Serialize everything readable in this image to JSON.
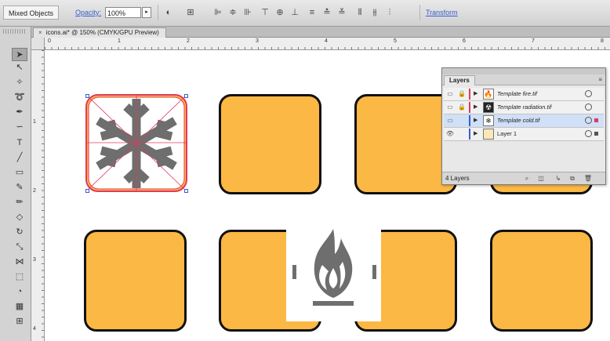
{
  "control_bar": {
    "selection_label": "Mixed Objects",
    "opacity_label": "Opacity:",
    "opacity_value": "100%",
    "transform_label": "Transform",
    "tool_icons": [
      "style-icon",
      "recolor-icon",
      "align-left-icon",
      "align-hcenter-icon",
      "align-right-icon",
      "align-top-icon",
      "align-vcenter-icon",
      "align-bottom-icon",
      "dist-top-icon",
      "dist-vcenter-icon",
      "dist-bottom-icon",
      "dist-left-icon",
      "dist-hcenter-icon",
      "dist-right-icon"
    ]
  },
  "document_tab": {
    "close_glyph": "×",
    "title": "icons.ai* @ 150% (CMYK/GPU Preview)"
  },
  "rulers": {
    "top_labels": [
      "0",
      "1",
      "2",
      "3",
      "4",
      "5",
      "6",
      "7",
      "8"
    ],
    "left_labels": [
      "1",
      "2",
      "3",
      "4"
    ]
  },
  "tools": [
    "selection",
    "direct-selection",
    "magic-wand",
    "lasso",
    "pen",
    "curvature",
    "type",
    "line-segment",
    "rectangle",
    "paintbrush",
    "pencil",
    "eraser",
    "rotate",
    "scale",
    "width",
    "free-transform",
    "shape-builder",
    "perspective-grid",
    "mesh"
  ],
  "canvas": {
    "tile_color": "#fbb844",
    "icon_color": "#6e6e6e",
    "selection_color": "#e03a5a"
  },
  "layers_panel": {
    "tab_label": "Layers",
    "count_label": "4 Layers",
    "layers": [
      {
        "name": "Template fire.tif",
        "template": true,
        "color": "#e03a5a",
        "thumb": "flame-icon",
        "active": false
      },
      {
        "name": "Template radiation.tif",
        "template": true,
        "color": "#e03a5a",
        "thumb": "radiation-icon",
        "active": false
      },
      {
        "name": "Template cold.tif",
        "template": true,
        "color": "#3a5fcd",
        "thumb": "snowflake-icon",
        "active": true
      },
      {
        "name": "Layer 1",
        "template": false,
        "color": "#3a5fcd",
        "thumb": "layer-thumb-icon",
        "active": false
      }
    ],
    "footer_icons": [
      "locate-object-icon",
      "make-clipping-mask-icon",
      "new-sublayer-icon",
      "new-layer-icon",
      "delete-layer-icon"
    ]
  }
}
